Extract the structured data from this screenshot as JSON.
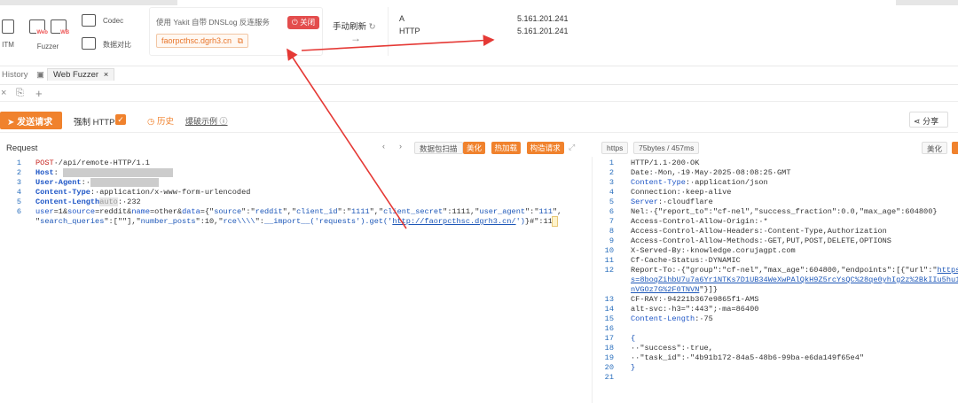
{
  "toolbar": {
    "codec_label": "Codec",
    "fuzzer_label": "Fuzzer",
    "datacompare_label": "数据对比",
    "itm_label": "ITM"
  },
  "dnslog": {
    "title": "使用 Yakit 自带 DNSLog 反连服务",
    "close_label": "关闭",
    "domain": "faorpcthsc.dgrh3.cn",
    "refresh_label": "手动刷新",
    "records": [
      {
        "type": "A",
        "ip": "5.161.201.241"
      },
      {
        "type": "HTTP",
        "ip": "5.161.201.241"
      }
    ]
  },
  "tabs": {
    "history_label": "History",
    "webfuzzer_label": "Web Fuzzer"
  },
  "actions": {
    "send_label": "发送请求",
    "force_https_label": "强制 HTTPS",
    "history_label": "历史",
    "example_label": "爆破示例",
    "share_label": "分享"
  },
  "request": {
    "title": "Request",
    "btn_scan": "数据包扫描",
    "btn_beautify": "美化",
    "btn_hotload": "热加载",
    "btn_build": "构造请求"
  },
  "response": {
    "tag_proto": "https",
    "tag_size": "75bytes / 457ms",
    "btn_beautify": "美化"
  },
  "colors": {
    "accent": "#f0822d",
    "danger": "#e34d4d",
    "link": "#1d57b8",
    "arrow": "#e53935"
  }
}
